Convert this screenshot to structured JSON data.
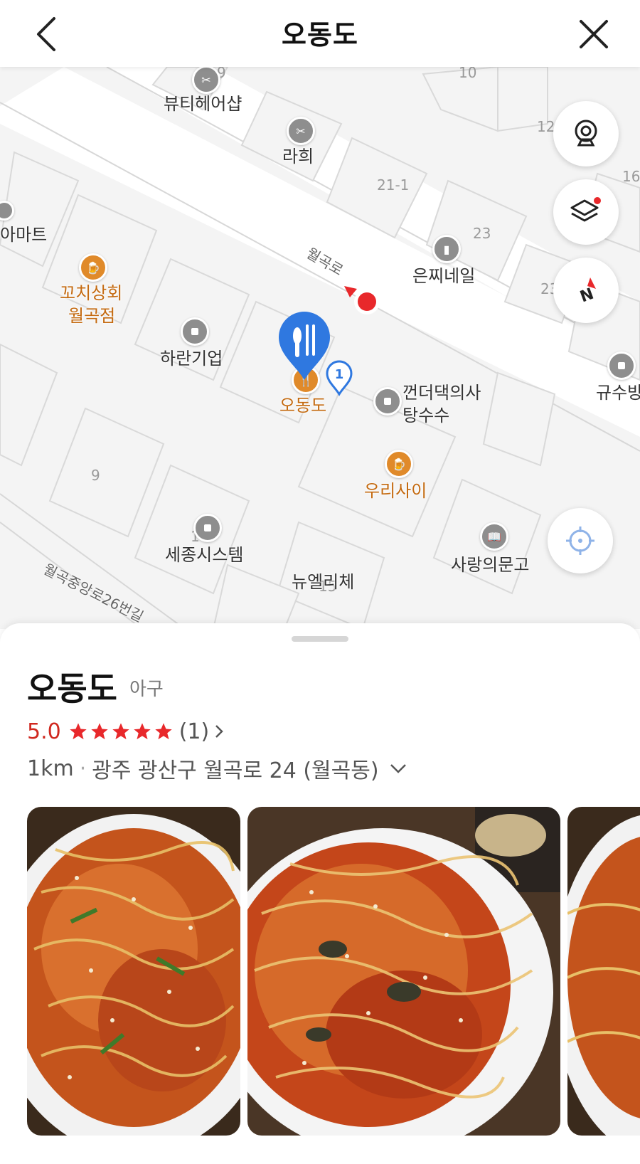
{
  "header": {
    "title": "오동도"
  },
  "map": {
    "labels": {
      "beauty": "뷰티헤어샵",
      "rahee": "라희",
      "amart": "아마트",
      "kkochi_1": "꼬치상회",
      "kkochi_2": "월곡점",
      "haran": "하란기업",
      "odongdo": "오동도",
      "kkeondeo_1": "껀더댁의사",
      "kkeondeo_2": "탕수수",
      "woori": "우리사이",
      "eunjji": "은찌네일",
      "gyusu": "규수방",
      "sejong": "세종시스템",
      "nyuel": "뉴엘리체",
      "sarang": "사랑의문고",
      "road_main": "월곡로",
      "road_side": "월곡중앙로26번길"
    },
    "numbers": {
      "n9a": "9",
      "n10": "10",
      "n12": "12",
      "n16": "16",
      "n21": "21-1",
      "n23": "23",
      "n23b": "23",
      "n9b": "9",
      "n15": "15",
      "n1": "1"
    },
    "pin_badge": "1"
  },
  "place": {
    "name": "오동도",
    "category": "아구",
    "score": "5.0",
    "stars": 5,
    "review_count": "(1)",
    "distance": "1km",
    "address": "광주 광산구 월곡로 24 (월곡동)"
  },
  "colors": {
    "accent_blue": "#2f78e0",
    "rating_red": "#d0281f",
    "poi_orange": "#e08a2a"
  }
}
